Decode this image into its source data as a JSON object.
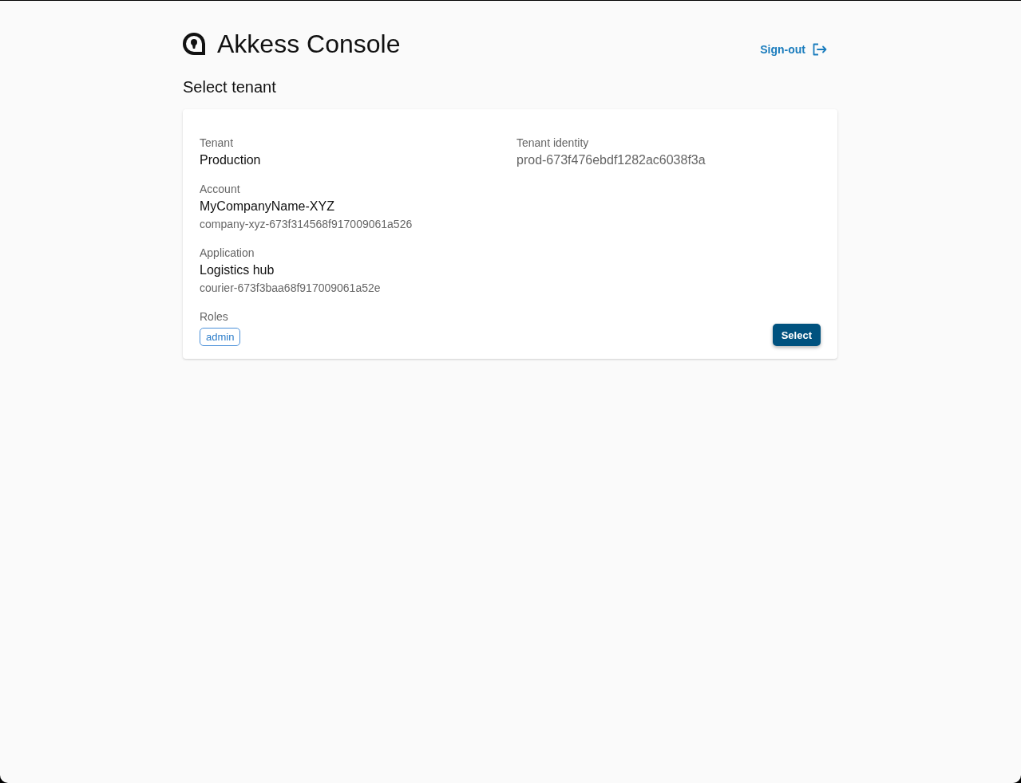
{
  "header": {
    "title": "Akkess Console",
    "sign_out": "Sign-out"
  },
  "heading": "Select tenant",
  "tenants": [
    {
      "tenant": {
        "label": "Tenant",
        "value": "Production"
      },
      "tenant_identity": {
        "label": "Tenant identity",
        "value": "prod-673f476ebdf1282ac6038f3a"
      },
      "account": {
        "label": "Account",
        "name": "MyCompanyName-XYZ",
        "id": "company-xyz-673f314568f917009061a526"
      },
      "application": {
        "label": "Application",
        "name": "Logistics hub",
        "id": "courier-673f3baa68f917009061a52e"
      },
      "roles": {
        "label": "Roles",
        "items": [
          "admin"
        ]
      },
      "button": "Select"
    }
  ]
}
